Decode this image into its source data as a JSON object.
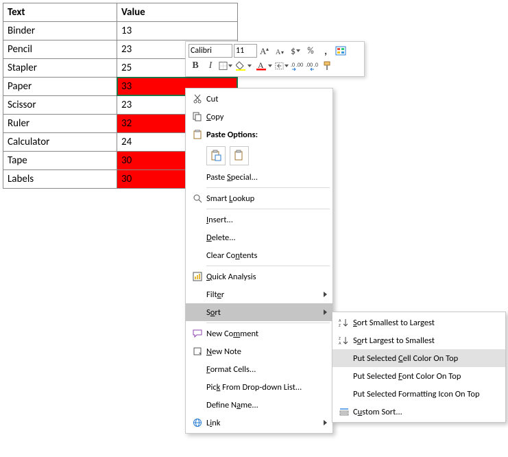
{
  "table": {
    "headers": {
      "text": "Text",
      "value": "Value"
    },
    "rows": [
      {
        "text": "Binder",
        "value": "13",
        "red": false
      },
      {
        "text": "Pencil",
        "value": "23",
        "red": false
      },
      {
        "text": "Stapler",
        "value": "25",
        "red": false
      },
      {
        "text": "Paper",
        "value": "33",
        "red": true,
        "selected": true
      },
      {
        "text": "Scissor",
        "value": "23",
        "red": false
      },
      {
        "text": "Ruler",
        "value": "32",
        "red": true
      },
      {
        "text": "Calculator",
        "value": "24",
        "red": false
      },
      {
        "text": "Tape",
        "value": "30",
        "red": true
      },
      {
        "text": "Labels",
        "value": "30",
        "red": true
      }
    ]
  },
  "colors": {
    "red": "#ff0000",
    "selection_border": "#217346"
  },
  "mini_toolbar": {
    "font_name": "Calibri",
    "font_size": "11"
  },
  "context_menu": {
    "cut": "Cut",
    "copy": "Copy",
    "paste_options": "Paste Options:",
    "paste_special": "Paste Special...",
    "smart_lookup": "Smart Lookup",
    "insert": "Insert...",
    "delete": "Delete...",
    "clear_contents": "Clear Contents",
    "quick_analysis": "Quick Analysis",
    "filter": "Filter",
    "sort": "Sort",
    "new_comment": "New Comment",
    "new_note": "New Note",
    "format_cells": "Format Cells...",
    "pick_from_list": "Pick From Drop-down List...",
    "define_name": "Define Name...",
    "link": "Link"
  },
  "sort_submenu": {
    "smallest_to_largest": "Sort Smallest to Largest",
    "largest_to_smallest": "Sort Largest to Smallest",
    "cell_color_top_pre": "Put Selected ",
    "cell_color_top_u": "C",
    "cell_color_top_post": "ell Color On Top",
    "font_color_top_pre": "Put Selected ",
    "font_color_top_u": "F",
    "font_color_top_post": "ont Color On Top",
    "formatting_icon_top": "Put Selected Formatting Icon On Top",
    "custom_sort_pre": "C",
    "custom_sort_u": "u",
    "custom_sort_post": "stom Sort..."
  }
}
